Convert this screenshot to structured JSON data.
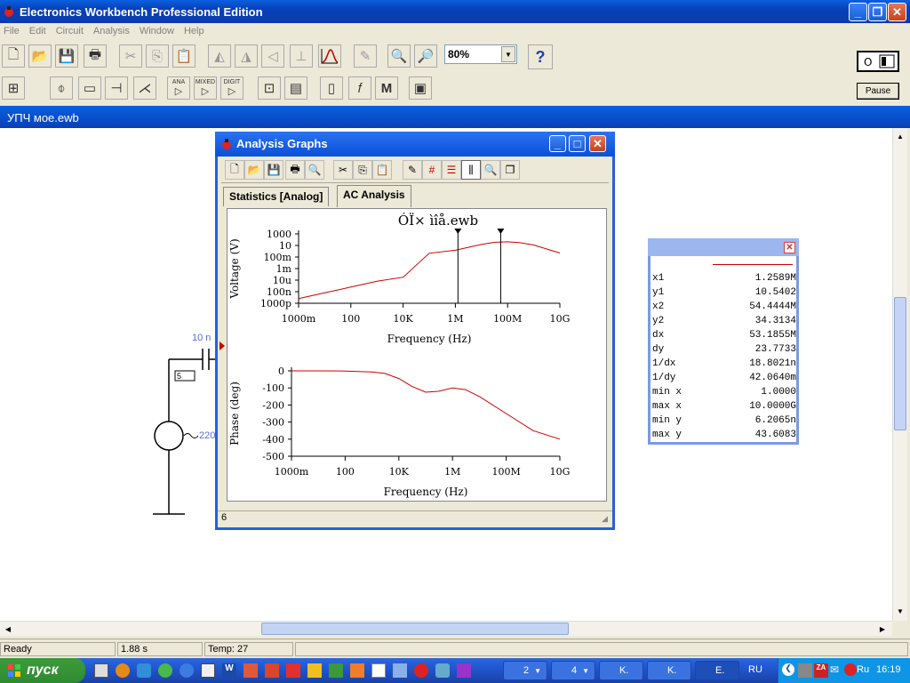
{
  "app": {
    "title": "Electronics Workbench Professional Edition"
  },
  "menu": [
    "File",
    "Edit",
    "Circuit",
    "Analysis",
    "Window",
    "Help"
  ],
  "toolbar": {
    "zoom": "80%",
    "help": "?",
    "pause": "Pause",
    "part_labels": [
      "ANA",
      "MIXED",
      "DIGIT"
    ]
  },
  "document": {
    "title": "УПЧ мое.ewb"
  },
  "circuit": {
    "cap_label": "10 n",
    "node_label": "5",
    "source_label": "220"
  },
  "analysis": {
    "title": "Analysis Graphs",
    "tabs": [
      "Statistics [Analog]",
      "AC Analysis"
    ],
    "graph_title": "ÓÏ× ìîå.ewb",
    "status": "6"
  },
  "chart_data": [
    {
      "type": "line",
      "title": "ÓÏ× ìîå.ewb",
      "xlabel": "Frequency (Hz)",
      "ylabel": "Voltage (V)",
      "xscale": "log",
      "yscale": "log",
      "x_ticks": [
        "1000m",
        "100",
        "10K",
        "1M",
        "100M",
        "10G"
      ],
      "y_ticks": [
        "1000",
        "10",
        "100m",
        "1m",
        "10u",
        "100n",
        "1000p"
      ],
      "xlim": [
        1,
        10000000000
      ],
      "ylim": [
        1e-09,
        1000
      ],
      "series": [
        {
          "color": "#cc0000",
          "x": [
            1,
            10,
            100,
            1000,
            10000,
            100000,
            1000000,
            3000000,
            10000000,
            30000000,
            100000000,
            300000000,
            1000000000,
            10000000000
          ],
          "y": [
            6.2e-09,
            6.2e-08,
            6.2e-07,
            6.2e-06,
            3.2e-05,
            0.45,
            1.5,
            4.5,
            15,
            34,
            43,
            30,
            12,
            0.5
          ]
        }
      ],
      "cursors": [
        1258900,
        54444400
      ]
    },
    {
      "type": "line",
      "xlabel": "Frequency (Hz)",
      "ylabel": "Phase (deg)",
      "xscale": "log",
      "x_ticks": [
        "1000m",
        "100",
        "10K",
        "1M",
        "100M",
        "10G"
      ],
      "y_ticks": [
        "0",
        "-100",
        "-200",
        "-300",
        "-400",
        "-500"
      ],
      "xlim": [
        1,
        10000000000
      ],
      "ylim": [
        -500,
        0
      ],
      "series": [
        {
          "color": "#cc0000",
          "x": [
            1,
            10,
            100,
            1000,
            3000,
            10000,
            30000,
            100000,
            300000,
            1000000,
            3000000,
            10000000,
            100000000,
            1000000000,
            10000000000
          ],
          "y": [
            0,
            0,
            -1,
            -6,
            -15,
            -45,
            -90,
            -125,
            -120,
            -100,
            -110,
            -150,
            -250,
            -350,
            -400
          ]
        }
      ]
    }
  ],
  "cursor_readout": [
    {
      "k": "x1",
      "v": "1.2589M"
    },
    {
      "k": "y1",
      "v": "10.5402"
    },
    {
      "k": "x2",
      "v": "54.4444M"
    },
    {
      "k": "y2",
      "v": "34.3134"
    },
    {
      "k": "dx",
      "v": "53.1855M"
    },
    {
      "k": "dy",
      "v": "23.7733"
    },
    {
      "k": "1/dx",
      "v": "18.8021n"
    },
    {
      "k": "1/dy",
      "v": "42.0640m"
    },
    {
      "k": "min x",
      "v": "1.0000"
    },
    {
      "k": "max x",
      "v": "10.0000G"
    },
    {
      "k": "min y",
      "v": "6.2065n"
    },
    {
      "k": "max y",
      "v": "43.6083"
    }
  ],
  "statusbar": {
    "ready": "Ready",
    "time": "1.88 s",
    "temp": "Temp: 27"
  },
  "taskbar": {
    "start": "пуск",
    "buttons": [
      {
        "label": "2"
      },
      {
        "label": "4"
      },
      {
        "label": "K."
      },
      {
        "label": "K."
      },
      {
        "label": "E."
      }
    ],
    "lang": "RU",
    "tray_lang": "Ru",
    "clock": "16:19"
  },
  "colors": {
    "accent": "#0a50d8",
    "trace": "#cc0000"
  }
}
